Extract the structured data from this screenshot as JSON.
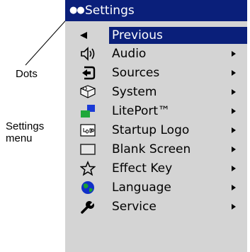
{
  "callouts": {
    "dots": "Dots",
    "settings_menu_line1": "Settings",
    "settings_menu_line2": "menu"
  },
  "menu": {
    "dots": "●●",
    "title": "Settings",
    "items": [
      {
        "label": "Previous",
        "icon": "back-arrow-icon",
        "selected": true,
        "submenu": false
      },
      {
        "label": "Audio",
        "icon": "speaker-icon",
        "submenu": true
      },
      {
        "label": "Sources",
        "icon": "source-input-icon",
        "submenu": true
      },
      {
        "label": "System",
        "icon": "system-icon",
        "submenu": true
      },
      {
        "label": "LitePort™",
        "icon": "liteport-icon",
        "submenu": true
      },
      {
        "label": "Startup Logo",
        "icon": "logo-icon",
        "submenu": true
      },
      {
        "label": "Blank Screen",
        "icon": "blank-screen-icon",
        "submenu": true
      },
      {
        "label": "Effect Key",
        "icon": "star-icon",
        "submenu": true
      },
      {
        "label": "Language",
        "icon": "globe-icon",
        "submenu": true
      },
      {
        "label": "Service",
        "icon": "wrench-icon",
        "submenu": true
      }
    ]
  },
  "colors": {
    "highlight": "#0a1f7a",
    "menu_background": "#d4d4d4"
  }
}
